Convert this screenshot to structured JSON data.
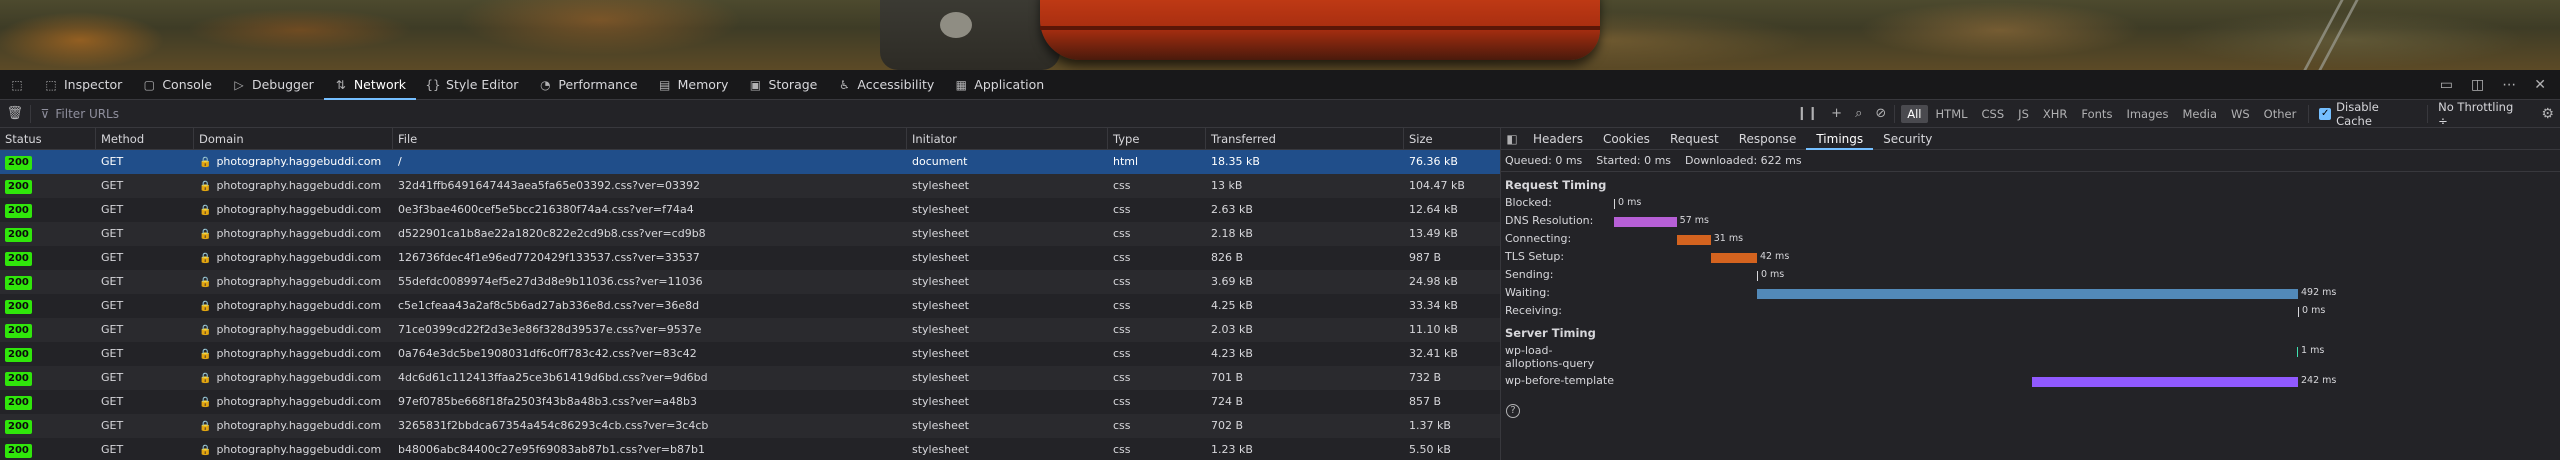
{
  "tabs": [
    {
      "label": "Inspector",
      "icon": "inspector-icon"
    },
    {
      "label": "Console",
      "icon": "console-icon"
    },
    {
      "label": "Debugger",
      "icon": "debugger-icon"
    },
    {
      "label": "Network",
      "icon": "network-icon",
      "active": true
    },
    {
      "label": "Style Editor",
      "icon": "braces-icon"
    },
    {
      "label": "Performance",
      "icon": "gauge-icon"
    },
    {
      "label": "Memory",
      "icon": "memory-icon"
    },
    {
      "label": "Storage",
      "icon": "storage-icon"
    },
    {
      "label": "Accessibility",
      "icon": "accessibility-icon"
    },
    {
      "label": "Application",
      "icon": "grid-icon"
    }
  ],
  "toolbar": {
    "filter_placeholder": "Filter URLs",
    "type_filters": [
      "All",
      "HTML",
      "CSS",
      "JS",
      "XHR",
      "Fonts",
      "Images",
      "Media",
      "WS",
      "Other"
    ],
    "active_type": "All",
    "disable_cache": "Disable Cache",
    "throttling": "No Throttling ÷"
  },
  "columns": [
    "Status",
    "Method",
    "Domain",
    "File",
    "Initiator",
    "Type",
    "Transferred",
    "Size"
  ],
  "requests": [
    {
      "status": "200",
      "method": "GET",
      "domain": "photography.haggebuddi.com",
      "file": "/",
      "initiator": "document",
      "type": "html",
      "transferred": "18.35 kB",
      "size": "76.36 kB",
      "selected": true
    },
    {
      "status": "200",
      "method": "GET",
      "domain": "photography.haggebuddi.com",
      "file": "32d41ffb6491647443aea5fa65e03392.css?ver=03392",
      "initiator": "stylesheet",
      "type": "css",
      "transferred": "13 kB",
      "size": "104.47 kB"
    },
    {
      "status": "200",
      "method": "GET",
      "domain": "photography.haggebuddi.com",
      "file": "0e3f3bae4600cef5e5bcc216380f74a4.css?ver=f74a4",
      "initiator": "stylesheet",
      "type": "css",
      "transferred": "2.63 kB",
      "size": "12.64 kB"
    },
    {
      "status": "200",
      "method": "GET",
      "domain": "photography.haggebuddi.com",
      "file": "d522901ca1b8ae22a1820c822e2cd9b8.css?ver=cd9b8",
      "initiator": "stylesheet",
      "type": "css",
      "transferred": "2.18 kB",
      "size": "13.49 kB"
    },
    {
      "status": "200",
      "method": "GET",
      "domain": "photography.haggebuddi.com",
      "file": "126736fdec4f1e96ed7720429f133537.css?ver=33537",
      "initiator": "stylesheet",
      "type": "css",
      "transferred": "826 B",
      "size": "987 B"
    },
    {
      "status": "200",
      "method": "GET",
      "domain": "photography.haggebuddi.com",
      "file": "55defdc0089974ef5e27d3d8e9b11036.css?ver=11036",
      "initiator": "stylesheet",
      "type": "css",
      "transferred": "3.69 kB",
      "size": "24.98 kB"
    },
    {
      "status": "200",
      "method": "GET",
      "domain": "photography.haggebuddi.com",
      "file": "c5e1cfeaa43a2af8c5b6ad27ab336e8d.css?ver=36e8d",
      "initiator": "stylesheet",
      "type": "css",
      "transferred": "4.25 kB",
      "size": "33.34 kB"
    },
    {
      "status": "200",
      "method": "GET",
      "domain": "photography.haggebuddi.com",
      "file": "71ce0399cd22f2d3e3e86f328d39537e.css?ver=9537e",
      "initiator": "stylesheet",
      "type": "css",
      "transferred": "2.03 kB",
      "size": "11.10 kB"
    },
    {
      "status": "200",
      "method": "GET",
      "domain": "photography.haggebuddi.com",
      "file": "0a764e3dc5be1908031df6c0ff783c42.css?ver=83c42",
      "initiator": "stylesheet",
      "type": "css",
      "transferred": "4.23 kB",
      "size": "32.41 kB"
    },
    {
      "status": "200",
      "method": "GET",
      "domain": "photography.haggebuddi.com",
      "file": "4dc6d61c112413ffaa25ce3b61419d6bd.css?ver=9d6bd",
      "initiator": "stylesheet",
      "type": "css",
      "transferred": "701 B",
      "size": "732 B"
    },
    {
      "status": "200",
      "method": "GET",
      "domain": "photography.haggebuddi.com",
      "file": "97ef0785be668f18fa2503f43b8a48b3.css?ver=a48b3",
      "initiator": "stylesheet",
      "type": "css",
      "transferred": "724 B",
      "size": "857 B"
    },
    {
      "status": "200",
      "method": "GET",
      "domain": "photography.haggebuddi.com",
      "file": "3265831f2bbdca67354a454c86293c4cb.css?ver=3c4cb",
      "initiator": "stylesheet",
      "type": "css",
      "transferred": "702 B",
      "size": "1.37 kB"
    },
    {
      "status": "200",
      "method": "GET",
      "domain": "photography.haggebuddi.com",
      "file": "b48006abc84400c27e95f69083ab87b1.css?ver=b87b1",
      "initiator": "stylesheet",
      "type": "css",
      "transferred": "1.23 kB",
      "size": "5.50 kB"
    }
  ],
  "details": {
    "tabs": [
      "Headers",
      "Cookies",
      "Request",
      "Response",
      "Timings",
      "Security"
    ],
    "active_tab": "Timings",
    "summary": {
      "queued": "Queued: 0 ms",
      "started": "Started: 0 ms",
      "downloaded": "Downloaded: 622 ms"
    },
    "request_timing_title": "Request Timing",
    "request_timings": [
      {
        "label": "Blocked:",
        "ms": 0,
        "start": 0,
        "value": "0 ms",
        "color": "#d7d7db"
      },
      {
        "label": "DNS Resolution:",
        "ms": 57,
        "start": 0,
        "value": "57 ms",
        "color": "#b65fd6"
      },
      {
        "label": "Connecting:",
        "ms": 31,
        "start": 57,
        "value": "31 ms",
        "color": "#d4631f"
      },
      {
        "label": "TLS Setup:",
        "ms": 42,
        "start": 88,
        "value": "42 ms",
        "color": "#d4631f"
      },
      {
        "label": "Sending:",
        "ms": 0,
        "start": 130,
        "value": "0 ms",
        "color": "#d7d7db"
      },
      {
        "label": "Waiting:",
        "ms": 492,
        "start": 130,
        "value": "492 ms",
        "color": "#5289b8"
      },
      {
        "label": "Receiving:",
        "ms": 0,
        "start": 622,
        "value": "0 ms",
        "color": "#d7d7db"
      }
    ],
    "server_timing_title": "Server Timing",
    "server_timings": [
      {
        "label": "wp-load-alloptions-query",
        "ms": 1,
        "start": 621,
        "value": "1 ms",
        "color": "#3fe1b0"
      },
      {
        "label": "wp-before-template",
        "ms": 242,
        "start": 380,
        "value": "242 ms",
        "color": "#9059ff"
      }
    ],
    "total_ms": 622
  }
}
